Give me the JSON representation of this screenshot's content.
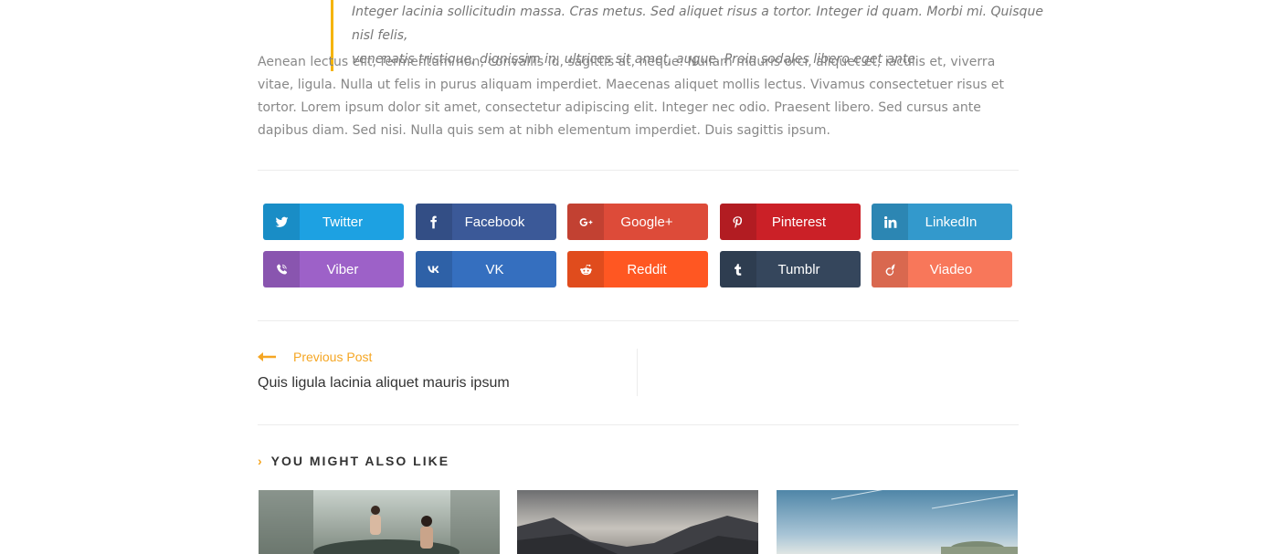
{
  "blockquote": {
    "line1": "Integer lacinia sollicitudin massa. Cras metus. Sed aliquet risus a tortor. Integer id quam. Morbi mi. Quisque nisl felis,",
    "line2": "venenatis tristique, dignissim in, ultrices sit amet, augue. Proin sodales libero eget ante."
  },
  "paragraph": "Aenean lectus elit, fermentum non, convallis id, sagittis at, neque. Nullam mauris orci, aliquet et, iaculis et, viverra vitae, ligula. Nulla ut felis in purus aliquam imperdiet. Maecenas aliquet mollis lectus. Vivamus consectetuer risus et tortor. Lorem ipsum dolor sit amet, consectetur adipiscing elit. Integer nec odio. Praesent libero. Sed cursus ante dapibus diam. Sed nisi. Nulla quis sem at nibh elementum imperdiet. Duis sagittis ipsum.",
  "share": [
    {
      "label": "Twitter",
      "icon": "twitter-icon",
      "color": "#1da1e2"
    },
    {
      "label": "Facebook",
      "icon": "facebook-icon",
      "color": "#3b5998"
    },
    {
      "label": "Google+",
      "icon": "google-plus-icon",
      "color": "#dd4b39"
    },
    {
      "label": "Pinterest",
      "icon": "pinterest-icon",
      "color": "#cb2027"
    },
    {
      "label": "LinkedIn",
      "icon": "linkedin-icon",
      "color": "#3399cc"
    },
    {
      "label": "Viber",
      "icon": "viber-icon",
      "color": "#9d61c8"
    },
    {
      "label": "VK",
      "icon": "vk-icon",
      "color": "#356fbf"
    },
    {
      "label": "Reddit",
      "icon": "reddit-icon",
      "color": "#ff5722"
    },
    {
      "label": "Tumblr",
      "icon": "tumblr-icon",
      "color": "#35465c"
    },
    {
      "label": "Viadeo",
      "icon": "viadeo-icon",
      "color": "#f8775a"
    }
  ],
  "post_nav": {
    "prev_label": "Previous Post",
    "prev_title": "Quis ligula lacinia aliquet mauris ipsum",
    "accent": "#f5a623"
  },
  "related": {
    "title": "YOU MIGHT ALSO LIKE"
  }
}
